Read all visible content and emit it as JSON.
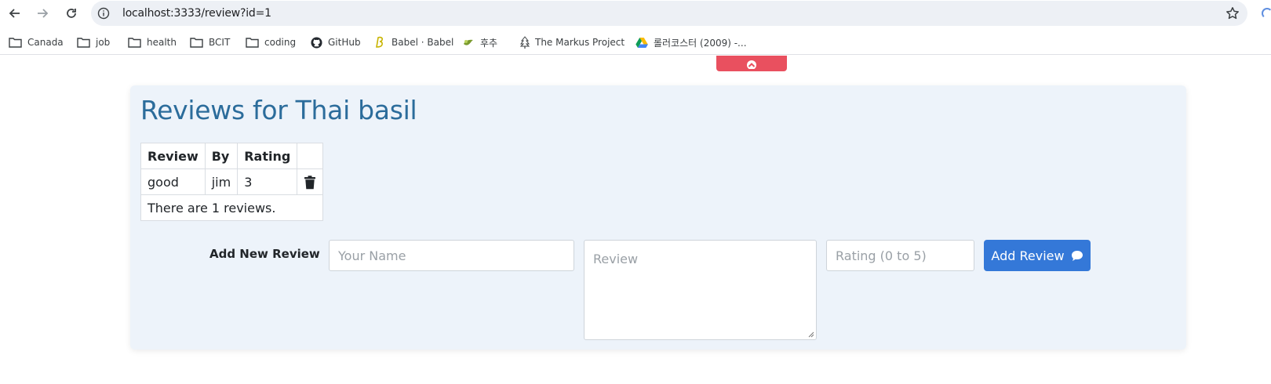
{
  "browser": {
    "url": "localhost:3333/review?id=1",
    "bookmarks": [
      {
        "label": "Canada",
        "icon": "folder-icon"
      },
      {
        "label": "job",
        "icon": "folder-icon"
      },
      {
        "label": "health",
        "icon": "folder-icon"
      },
      {
        "label": "BCIT",
        "icon": "folder-icon"
      },
      {
        "label": "coding",
        "icon": "folder-icon"
      },
      {
        "label": "GitHub",
        "icon": "github-icon"
      },
      {
        "label": "Babel · Babel",
        "icon": "babel-icon"
      },
      {
        "label": "후추",
        "icon": "pepper-icon"
      },
      {
        "label": "The Markus Project",
        "icon": "tree-icon"
      },
      {
        "label": "롤러코스터 (2009) -...",
        "icon": "drive-icon"
      }
    ]
  },
  "page": {
    "title": "Reviews for Thai basil",
    "table": {
      "headers": [
        "Review",
        "By",
        "Rating",
        ""
      ],
      "rows": [
        {
          "review": "good",
          "by": "jim",
          "rating": "3"
        }
      ],
      "footer": "There are 1 reviews."
    },
    "form": {
      "label": "Add New Review",
      "name_placeholder": "Your Name",
      "review_placeholder": "Review",
      "rating_placeholder": "Rating (0 to 5)",
      "submit_label": "Add Review"
    }
  },
  "colors": {
    "accent": "#3478d8",
    "title": "#2b6c9b",
    "card_bg": "#edf3fa",
    "top_tab": "#e9505f"
  }
}
